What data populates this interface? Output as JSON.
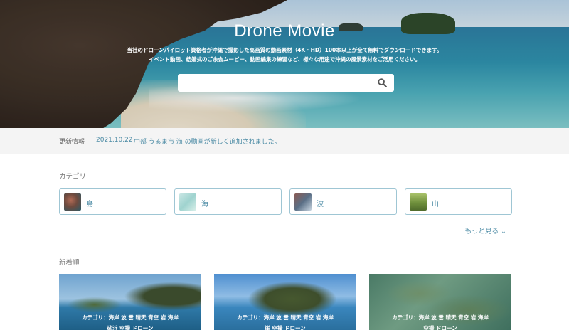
{
  "hero": {
    "title": "Drone Movie",
    "desc_line1": "当社のドローンパイロット資格者が沖縄で撮影した高画質の動画素材（4K・HD）100本以上が全て無料でダウンロードできます。",
    "desc_line2": "イベント動画、結婚式のご余会ムービー、動画編集の練習など、様々な用途で沖縄の風景素材をご活用ください。",
    "search_placeholder": "",
    "search_icon": "search-icon"
  },
  "news": {
    "label": "更新情報",
    "date": "2021.10.22",
    "message": "中部 うるま市 海 の動画が新しく追加されました。"
  },
  "categories": {
    "title": "カテゴリ",
    "items": [
      {
        "label": "島"
      },
      {
        "label": "海"
      },
      {
        "label": "波"
      },
      {
        "label": "山"
      }
    ],
    "more": "もっと見る ⌄"
  },
  "new_arrivals": {
    "title": "新着順",
    "cards": [
      {
        "tags_line1": "カテゴリ：海岸 波 雲 晴天 青空 岩 海岸",
        "tags_line2": "砂浜 空撮 ドローン"
      },
      {
        "tags_line1": "カテゴリ：海岸 波 雲 晴天 青空 岩 海岸",
        "tags_line2": "崖 空撮 ドローン"
      },
      {
        "tags_line1": "カテゴリ：海岸 波 雲 晴天 青空 岩 海岸",
        "tags_line2": "空撮 ドローン"
      }
    ]
  },
  "colors": {
    "accent": "#4a8aa4",
    "border": "#9fc6d4",
    "news_bg": "#f4f4f4"
  }
}
